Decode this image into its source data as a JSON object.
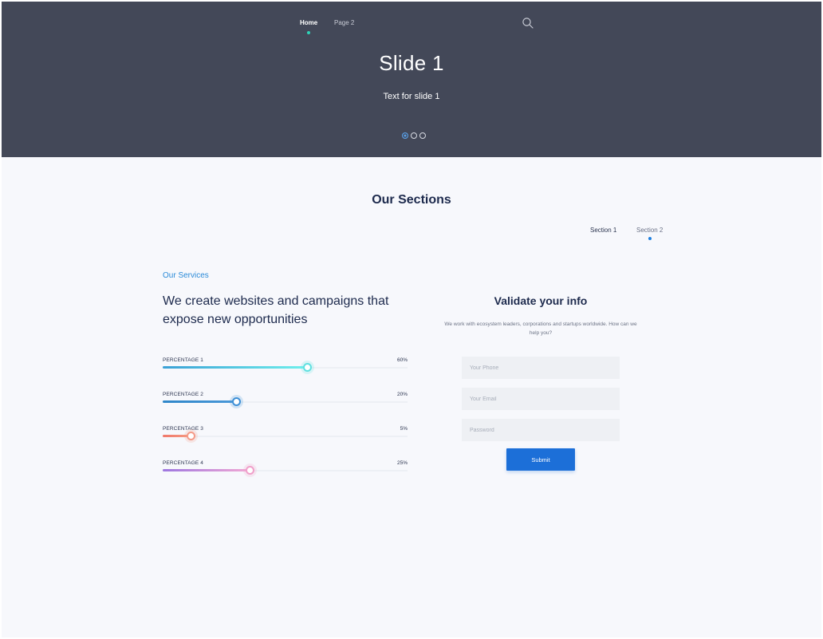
{
  "nav": {
    "items": [
      {
        "label": "Home",
        "active": true
      },
      {
        "label": "Page 2",
        "active": false
      }
    ],
    "search_icon": "search-icon"
  },
  "hero": {
    "title": "Slide 1",
    "text": "Text for slide 1",
    "slide_count": 3,
    "active_slide": 1
  },
  "sections": {
    "title": "Our Sections",
    "tabs": [
      {
        "label": "Section 1",
        "active": false
      },
      {
        "label": "Section 2",
        "active": true
      }
    ]
  },
  "services": {
    "label": "Our Services",
    "heading": "We create websites and campaigns that expose new opportunities",
    "progress": [
      {
        "label": "PERCENTAGE 1",
        "value_text": "60%",
        "fill_fraction": 0.59,
        "colors": [
          "#3aa0d6",
          "#6ff0ec"
        ],
        "knob_color": "#5fe0e0"
      },
      {
        "label": "PERCENTAGE 2",
        "value_text": "20%",
        "fill_fraction": 0.3,
        "colors": [
          "#2e86c9",
          "#4a98d8"
        ],
        "knob_color": "#3d8fd6"
      },
      {
        "label": "PERCENTAGE 3",
        "value_text": "5%",
        "fill_fraction": 0.115,
        "colors": [
          "#f0786a",
          "#f59a82"
        ],
        "knob_color": "#f49a88"
      },
      {
        "label": "PERCENTAGE 4",
        "value_text": "25%",
        "fill_fraction": 0.355,
        "colors": [
          "#9e77e0",
          "#f2a8d4"
        ],
        "knob_color": "#f09fca"
      }
    ]
  },
  "form": {
    "title": "Validate your info",
    "description": "We work with ecosystem leaders, corporations and startups worldwide. How can we help you?",
    "fields": {
      "phone_placeholder": "Your Phone",
      "email_placeholder": "Your Email",
      "password_placeholder": "Password"
    },
    "submit_label": "Submit"
  },
  "colors": {
    "hero_bg": "#434858",
    "accent": "#1c6fd8",
    "nav_dot": "#2ed3b7"
  }
}
